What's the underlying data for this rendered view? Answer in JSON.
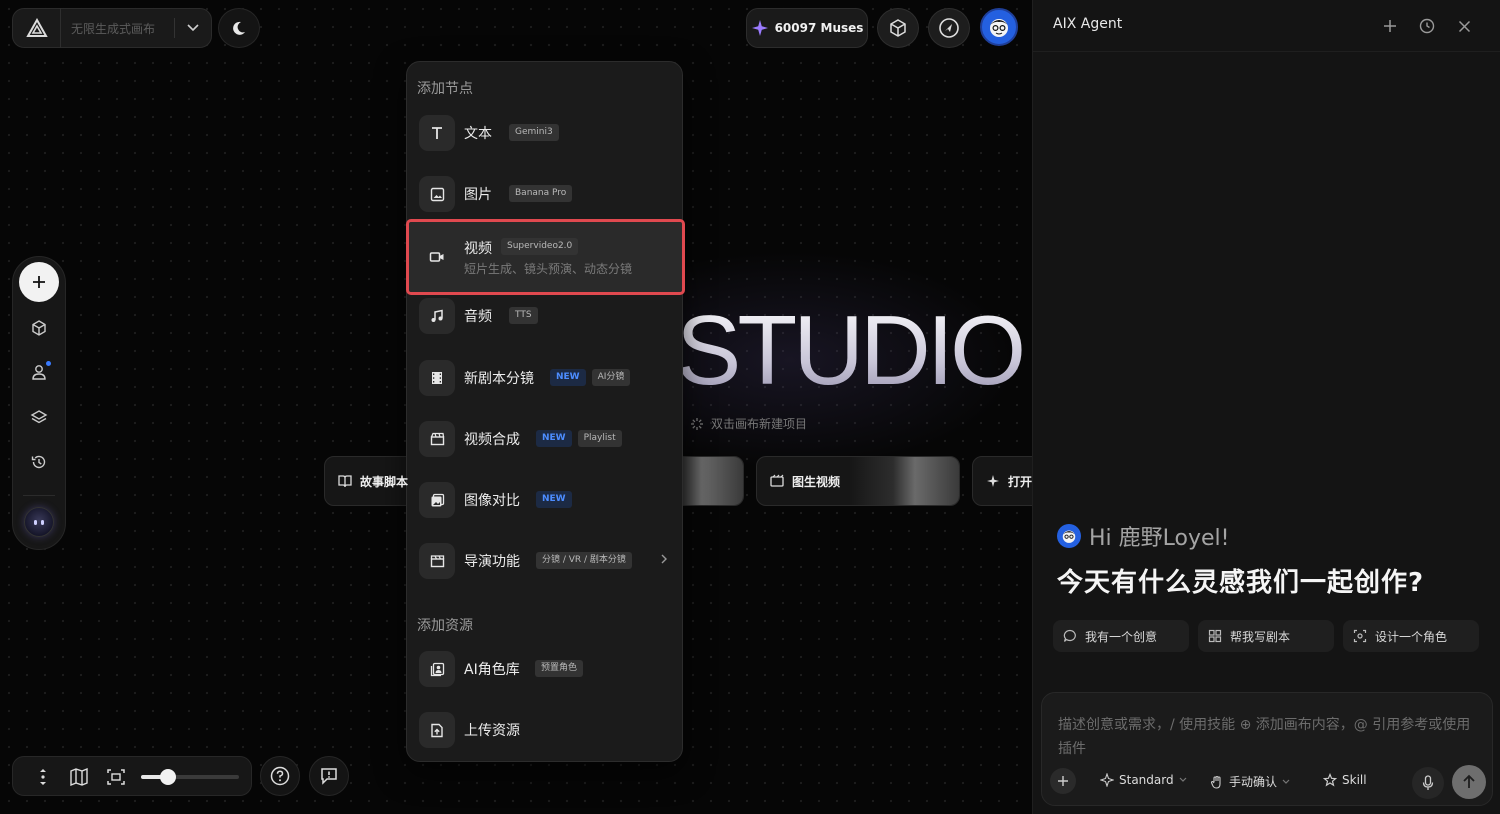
{
  "project": {
    "name": "无限生成式画布"
  },
  "topbar": {
    "muses_label": "60097 Muses"
  },
  "studio": {
    "title": "STUDIO",
    "hint": "双击画布新建项目"
  },
  "shortcuts": [
    {
      "label": "故事脚本"
    },
    {
      "label": "图生视频"
    },
    {
      "label": "打开"
    }
  ],
  "zoom": {
    "level": 0.28
  },
  "menu": {
    "section_nodes": "添加节点",
    "items": [
      {
        "label": "文本",
        "icon": "text-icon",
        "tags": [
          "Gemini3"
        ]
      },
      {
        "label": "图片",
        "icon": "image-icon",
        "tags": [
          "Banana Pro"
        ]
      },
      {
        "label": "视频",
        "icon": "video-icon",
        "tags": [
          "Supervideo2.0"
        ],
        "sub": "短片生成、镜头预演、动态分镜"
      },
      {
        "label": "音频",
        "icon": "music-icon",
        "tags": [
          "TTS"
        ]
      },
      {
        "label": "新剧本分镜",
        "icon": "film-icon",
        "tags": [
          "NEW",
          "AI分镜"
        ]
      },
      {
        "label": "视频合成",
        "icon": "clapper-icon",
        "tags": [
          "NEW",
          "Playlist"
        ]
      },
      {
        "label": "图像对比",
        "icon": "compare-icon",
        "tags": [
          "NEW"
        ]
      },
      {
        "label": "导演功能",
        "icon": "director-icon",
        "tags": [
          "分镜 / VR / 剧本分镜"
        ]
      }
    ],
    "section_assets": "添加资源",
    "assets": [
      {
        "label": "AI角色库",
        "icon": "character-library-icon",
        "tags": [
          "预置角色"
        ]
      },
      {
        "label": "上传资源",
        "icon": "upload-icon",
        "tags": []
      }
    ]
  },
  "agent": {
    "title": "AIX Agent",
    "greeting": "Hi 鹿野Loyel!",
    "headline": "今天有什么灵感我们一起创作?",
    "chips": [
      {
        "label": "我有一个创意",
        "icon": "chat-bubble-icon"
      },
      {
        "label": "帮我写剧本",
        "icon": "grid-icon"
      },
      {
        "label": "设计一个角色",
        "icon": "scan-face-icon"
      }
    ],
    "composer": {
      "placeholder": "描述创意或需求，/ 使用技能 ⊕ 添加画布内容，@ 引用参考或使用插件",
      "mode": "Standard",
      "confirm": "手动确认",
      "skill": "Skill"
    }
  },
  "colors": {
    "highlight": "#e0494f",
    "new_tag": "#4d8dff",
    "avatar": "#2460e0"
  }
}
